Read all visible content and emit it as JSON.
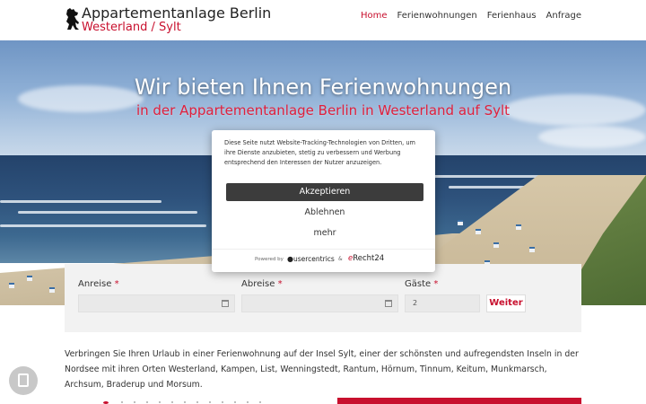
{
  "header": {
    "logo_title": "Appartementanlage Berlin",
    "logo_subtitle": "Westerland / Sylt",
    "logo_icon": "berlin-bear-icon",
    "nav": [
      "Home",
      "Ferienwohnungen",
      "Ferienhaus",
      "Anfrage"
    ],
    "active_nav": "Home"
  },
  "hero": {
    "title": "Wir bieten Ihnen Ferienwohnungen",
    "subtitle": "in der Appartementanlage Berlin in Westerland auf Sylt"
  },
  "consent": {
    "text": "Diese Seite nutzt Website-Tracking-Technologien von Dritten, um ihre Dienste anzubieten, stetig zu verbessern und Werbung entsprechend den Interessen der Nutzer anzuzeigen.",
    "accept_label": "Akzeptieren",
    "decline_label": "Ablehnen",
    "more_label": "mehr",
    "powered_by": "Powered by",
    "provider": "usercentrics",
    "amp": "&",
    "partner_prefix": "e",
    "partner_rest": "Recht24"
  },
  "booking": {
    "arrival_label": "Anreise",
    "departure_label": "Abreise",
    "guests_label": "Gäste",
    "required_mark": "*",
    "guests_value": "2",
    "submit_label": "Weiter"
  },
  "intro": "Verbringen Sie Ihren Urlaub in einer Ferienwohnung auf der Insel Sylt, einer der schönsten und aufregendsten Inseln in der Nordsee mit ihren Orten Westerland, Kampen, List, Wenningstedt, Rantum, Hörnum, Tinnum, Keitum, Munkmarsch, Archsum, Braderup und Morsum.",
  "colors": {
    "accent": "#c8102e",
    "consent_button": "#3c3c3c",
    "booking_bg": "#f2f2f2"
  }
}
